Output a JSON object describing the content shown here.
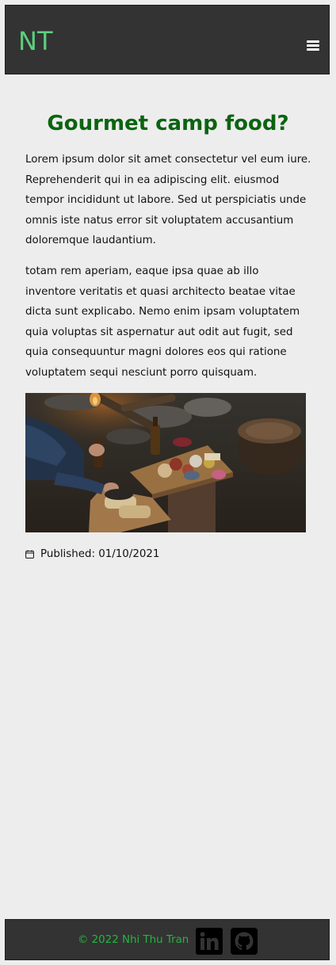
{
  "header": {
    "logo": "NT",
    "menu_icon": "hamburger-menu-icon",
    "logo_color": "#5ccf7d",
    "bar_color": "#333333"
  },
  "article": {
    "title": "Gourmet camp food?",
    "title_color": "#0b6410",
    "paragraphs": [
      "Lorem ipsum dolor sit amet consectetur vel eum iure. Reprehenderit qui in ea adipiscing elit. eiusmod tempor incididunt ut labore. Sed ut perspiciatis unde omnis iste natus error sit voluptatem accusantium doloremque laudantium.",
      "totam rem aperiam, eaque ipsa quae ab illo inventore veritatis et quasi architecto beatae vitae dicta sunt explicabo. Nemo enim ipsam voluptatem quia voluptas sit aspernatur aut odit aut fugit, sed quia consequuntur magni dolores eos qui ratione voluptatem sequi nesciunt porro quisquam."
    ],
    "image_icon": "camp-food-photo",
    "published_icon": "calendar-icon",
    "published": "Published: 01/10/2021"
  },
  "footer": {
    "copyright": "© 2022 Nhi Thu Tran",
    "copyright_color": "#25b540",
    "social": [
      {
        "icon": "linkedin-icon"
      },
      {
        "icon": "github-icon"
      }
    ]
  }
}
